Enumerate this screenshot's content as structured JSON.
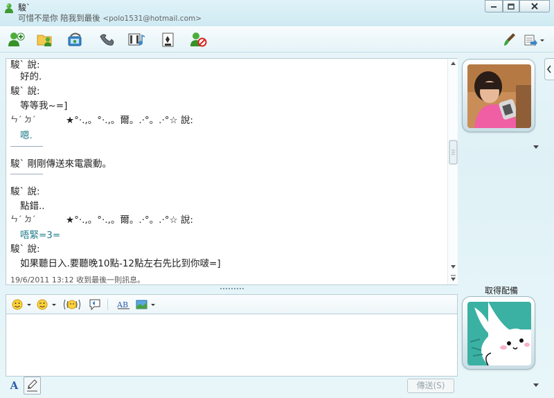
{
  "window": {
    "contact_name": "駿`",
    "subtitle": "可惜不是你 陪我到最後",
    "email": "<polo1531@hotmail.com>",
    "controls": {
      "minimize": "–",
      "maximize": "□",
      "close": "✕"
    }
  },
  "toolbar": {
    "items": [
      "invite-contact-icon",
      "share-files-icon",
      "video-call-icon",
      "call-icon",
      "activities-icon",
      "games-icon",
      "block-contact-icon"
    ],
    "right_items": [
      "paintbrush-icon",
      "menu-icon"
    ]
  },
  "history": {
    "lines": [
      {
        "text": "駿` 說:",
        "kind": "sender"
      },
      {
        "text": "好的.",
        "kind": "message"
      },
      {
        "text": "駿` 說:",
        "kind": "sender"
      },
      {
        "text": "等等我~=]",
        "kind": "message"
      },
      {
        "text": "ㄣˊ ㄉˊ",
        "kind": "sender-a"
      },
      {
        "text": "★°‧.,。°‧.,。爾。.‧°。.‧°☆ 說:",
        "kind": "sender-b"
      },
      {
        "text": "嗯.",
        "kind": "message-teal"
      },
      {
        "text": "駿` 剛剛傳送來電震動。",
        "kind": "notice"
      },
      {
        "text": "駿` 說:",
        "kind": "sender"
      },
      {
        "text": "點錯..",
        "kind": "message"
      },
      {
        "text": "ㄣˊ ㄉˊ",
        "kind": "sender-a"
      },
      {
        "text": "★°‧.,。°‧.,。爾。.‧°。.‧°☆ 說:",
        "kind": "sender-b"
      },
      {
        "text": "唔緊=3=",
        "kind": "message-teal"
      },
      {
        "text": "駿` 說:",
        "kind": "sender"
      },
      {
        "text": "如果聽日入.要聽晚10點-12點左右先比到你啵=]",
        "kind": "message"
      }
    ],
    "last_message": "19/6/2011 13:12 收到最後一則訊息。"
  },
  "compose": {
    "toolbar_items": [
      "emoticon-icon",
      "wink-icon",
      "nudge-icon",
      "voice-clip-icon",
      "handwriting-icon",
      "background-icon"
    ],
    "input_value": "",
    "font_label": "A",
    "send_label": "傳送(S)"
  },
  "side": {
    "get_accessory": "取得配備"
  },
  "colors": {
    "accent": "#1d7a8a",
    "frame": "#dff1f6"
  }
}
